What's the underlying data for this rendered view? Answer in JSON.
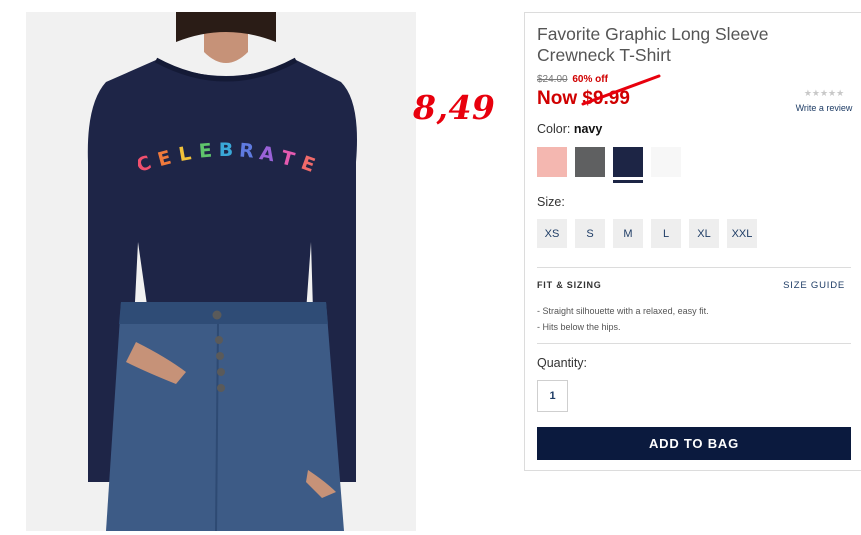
{
  "annotation": {
    "handwritten_price": "8,49"
  },
  "product": {
    "title": "Favorite Graphic Long Sleeve Crewneck T-Shirt",
    "graphic_text": "CELEBRATE",
    "original_price": "$24.00",
    "discount": "60% off",
    "now_label": "Now",
    "sale_price": "$9.99",
    "review_link": "Write a review",
    "stars": "★★★★★",
    "color_label": "Color:",
    "selected_color": "navy",
    "swatches": [
      {
        "name": "pink",
        "color": "#f4b7b0"
      },
      {
        "name": "gray",
        "color": "#5f6061"
      },
      {
        "name": "navy",
        "color": "#1d2545"
      },
      {
        "name": "white",
        "color": "#f7f7f7"
      }
    ],
    "size_label": "Size:",
    "sizes": [
      "XS",
      "S",
      "M",
      "L",
      "XL",
      "XXL"
    ],
    "fit_heading": "FIT & SIZING",
    "size_guide": "SIZE GUIDE",
    "fit_points": [
      "- Straight silhouette with a relaxed, easy fit.",
      "- Hits below the hips."
    ],
    "quantity_label": "Quantity:",
    "quantity": "1",
    "add_to_bag": "ADD TO BAG"
  },
  "colors": {
    "accent_red": "#d00000",
    "button_navy": "#0b1a3e",
    "link_blue": "#1f3d66"
  }
}
